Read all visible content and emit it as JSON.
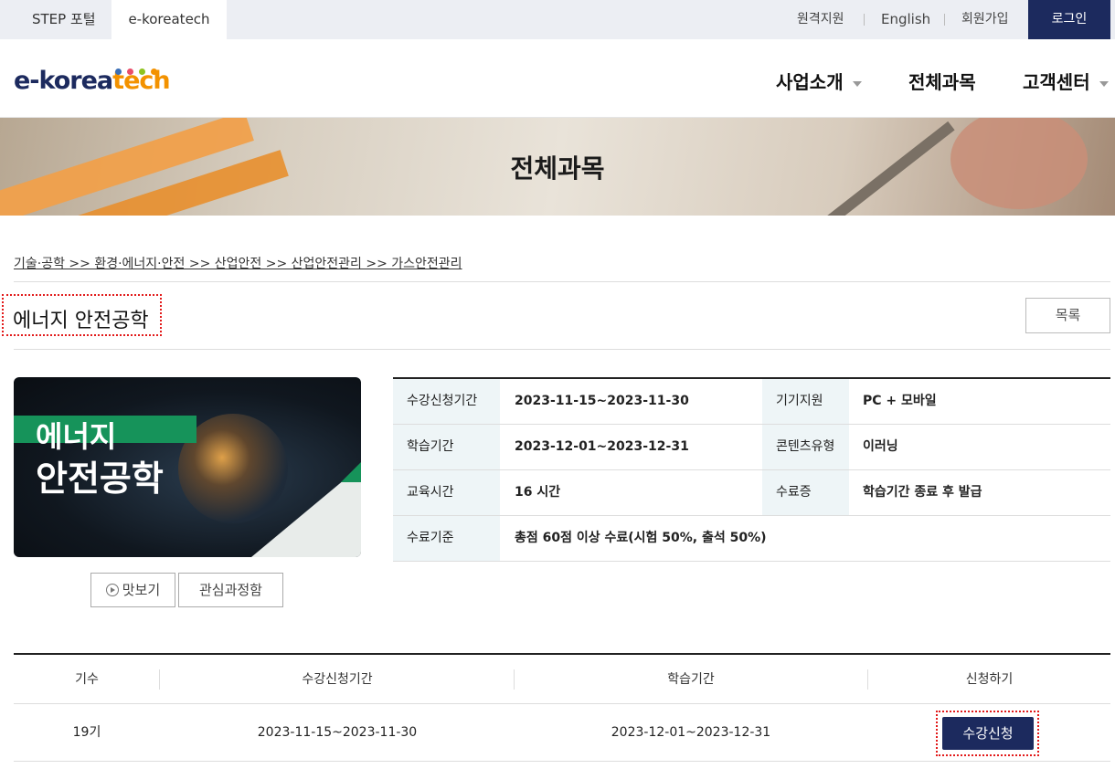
{
  "topbar": {
    "tabs": [
      "STEP 포털",
      "e-koreatech"
    ],
    "links": [
      "원격지원",
      "English",
      "회원가입"
    ],
    "login_label": "로그인"
  },
  "header": {
    "logo_main": "e-korea",
    "logo_accent": "tech",
    "logo_dot_colors": [
      "#3b6fb6",
      "#e94e6b",
      "#8fc31f",
      "#f39200"
    ],
    "nav": [
      "사업소개",
      "전체과목",
      "고객센터"
    ]
  },
  "banner": {
    "title": "전체과목"
  },
  "breadcrumb": "기술·공학 >> 환경·에너지·안전 >> 산업안전 >> 산업안전관리 >> 가스안전관리",
  "course": {
    "title": "에너지 안전공학",
    "list_label": "목록",
    "thumbnail_line1": "에너지",
    "thumbnail_line2": "안전공학",
    "preview_label": "맛보기",
    "favorite_label": "관심과정함"
  },
  "info": {
    "rows": [
      {
        "label1": "수강신청기간",
        "value1": "2023-11-15~2023-11-30",
        "label2": "기기지원",
        "value2": "PC + 모바일"
      },
      {
        "label1": "학습기간",
        "value1": "2023-12-01~2023-12-31",
        "label2": "콘텐츠유형",
        "value2": "이러닝"
      },
      {
        "label1": "교육시간",
        "value1": "16 시간",
        "label2": "수료증",
        "value2": "학습기간 종료 후 발급"
      },
      {
        "label1": "수료기준",
        "value1": "총점 60점 이상 수료(시험 50%, 출석 50%)"
      }
    ]
  },
  "sessions": {
    "headers": [
      "기수",
      "수강신청기간",
      "학습기간",
      "신청하기"
    ],
    "rows": [
      {
        "term": "19기",
        "apply_period": "2023-11-15~2023-11-30",
        "study_period": "2023-12-01~2023-12-31",
        "action": "수강신청"
      }
    ]
  },
  "colors": {
    "primary": "#1c2a5e",
    "accent": "#f39200",
    "highlight": "#e21a1a"
  }
}
